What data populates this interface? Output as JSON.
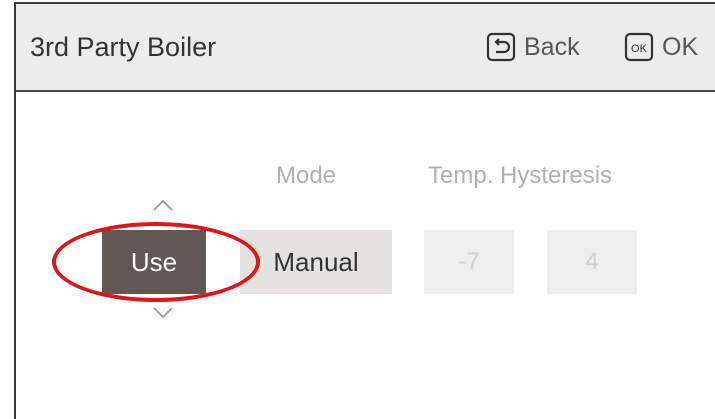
{
  "header": {
    "title": "3rd Party Boiler",
    "back_label": "Back",
    "ok_label": "OK",
    "ok_icon_text": "OK"
  },
  "columns": {
    "mode_label": "Mode",
    "temp_label": "Temp. Hysteresis"
  },
  "values": {
    "use": "Use",
    "mode": "Manual",
    "temp_low": "-7",
    "temp_high": "4"
  },
  "colors": {
    "selected_bg": "#615752",
    "highlight_ring": "#e3121b"
  }
}
